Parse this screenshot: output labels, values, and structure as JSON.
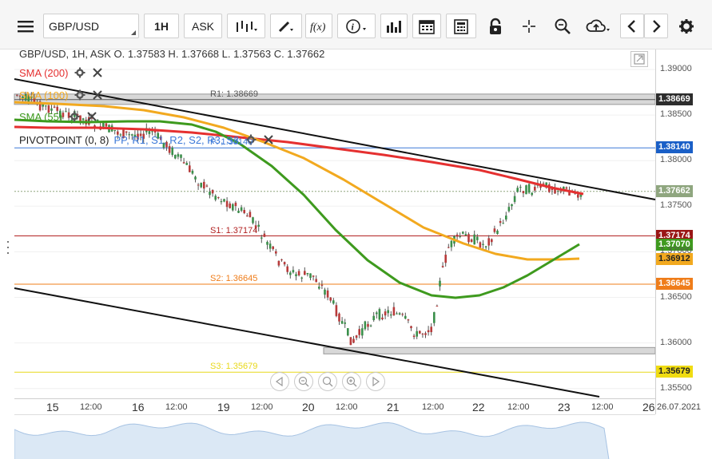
{
  "toolbar": {
    "menu_icon": "hamburger-icon",
    "symbol": "GBP/USD",
    "timeframe": "1H",
    "price_type": "ASK",
    "buttons": [
      "candles-icon",
      "pencil-icon",
      "fx-icon",
      "info-icon",
      "bar-chart-icon",
      "calendar-icon",
      "calculator-icon",
      "lock-icon",
      "crosshair-icon",
      "zoom-icon",
      "cloud-icon",
      "chevron-left-icon",
      "chevron-right-icon",
      "gear-icon"
    ]
  },
  "chart": {
    "ohlc_line": "GBP/USD, 1H, ASK    O. 1.37583 H. 1.37668 L. 1.37563 C. 1.37662",
    "indicators": [
      {
        "label": "SMA (200)",
        "color": "#e53030"
      },
      {
        "label": "SMA (100)",
        "color": "#f2a91f"
      },
      {
        "label": "SMA (55)",
        "color": "#3e9a1e"
      },
      {
        "label": "PIVOTPOINT (0, 8)",
        "color": "#222222",
        "suffix": "PP, R1, S1, R2, S2, R3, S3"
      }
    ],
    "pivots": [
      {
        "label": "R1: 1.38669",
        "value": 1.38669,
        "color": "#555555",
        "tag_color": "#2d2d2d",
        "tag": "1.38669"
      },
      {
        "label": "P: 1.38140",
        "value": 1.3814,
        "color": "#3b78d8",
        "tag_color": "#1a5fc7",
        "tag": "1.38140"
      },
      {
        "label": "S1: 1.37174",
        "value": 1.37174,
        "color": "#b22222",
        "tag_color": "#9a1616",
        "tag": "1.37174"
      },
      {
        "label": "S2: 1.36645",
        "value": 1.36645,
        "color": "#ef7d1a",
        "tag_color": "#ef7d1a",
        "tag": "1.36645"
      },
      {
        "label": "S3: 1.35679",
        "value": 1.35679,
        "color": "#e8d81a",
        "tag_color": "#f0dc12",
        "tag": "1.35679"
      }
    ],
    "current_price": {
      "value": 1.37662,
      "tag": "1.37662",
      "color": "#8fa67f"
    },
    "sma_tags": [
      {
        "tag": "1.37070",
        "value": 1.3707,
        "color": "#3e9a1e"
      },
      {
        "tag": "1.36912",
        "value": 1.36912,
        "color": "#f2a91f"
      }
    ],
    "y_ticks": [
      "1.39000",
      "1.38500",
      "1.38000",
      "1.37500",
      "1.37000",
      "1.36500",
      "1.36000",
      "1.35500"
    ],
    "y_tick_values": [
      1.39,
      1.385,
      1.38,
      1.375,
      1.37,
      1.365,
      1.36,
      1.355
    ],
    "x_labels": [
      {
        "text": "15",
        "day": true
      },
      {
        "text": "12:00",
        "day": false
      },
      {
        "text": "16",
        "day": true
      },
      {
        "text": "12:00",
        "day": false
      },
      {
        "text": "19",
        "day": true
      },
      {
        "text": "12:00",
        "day": false
      },
      {
        "text": "20",
        "day": true
      },
      {
        "text": "12:00",
        "day": false
      },
      {
        "text": "21",
        "day": true
      },
      {
        "text": "12:00",
        "day": false
      },
      {
        "text": "22",
        "day": true
      },
      {
        "text": "12:00",
        "day": false
      },
      {
        "text": "23",
        "day": true
      },
      {
        "text": "12:00",
        "day": false
      },
      {
        "text": "26",
        "day": true
      },
      {
        "text": "26.07.2021",
        "day": false
      }
    ]
  },
  "zoom_controls": [
    "arrow-left-icon",
    "zoom-out-icon",
    "reset-zoom-icon",
    "zoom-in-icon",
    "arrow-right-icon"
  ]
}
